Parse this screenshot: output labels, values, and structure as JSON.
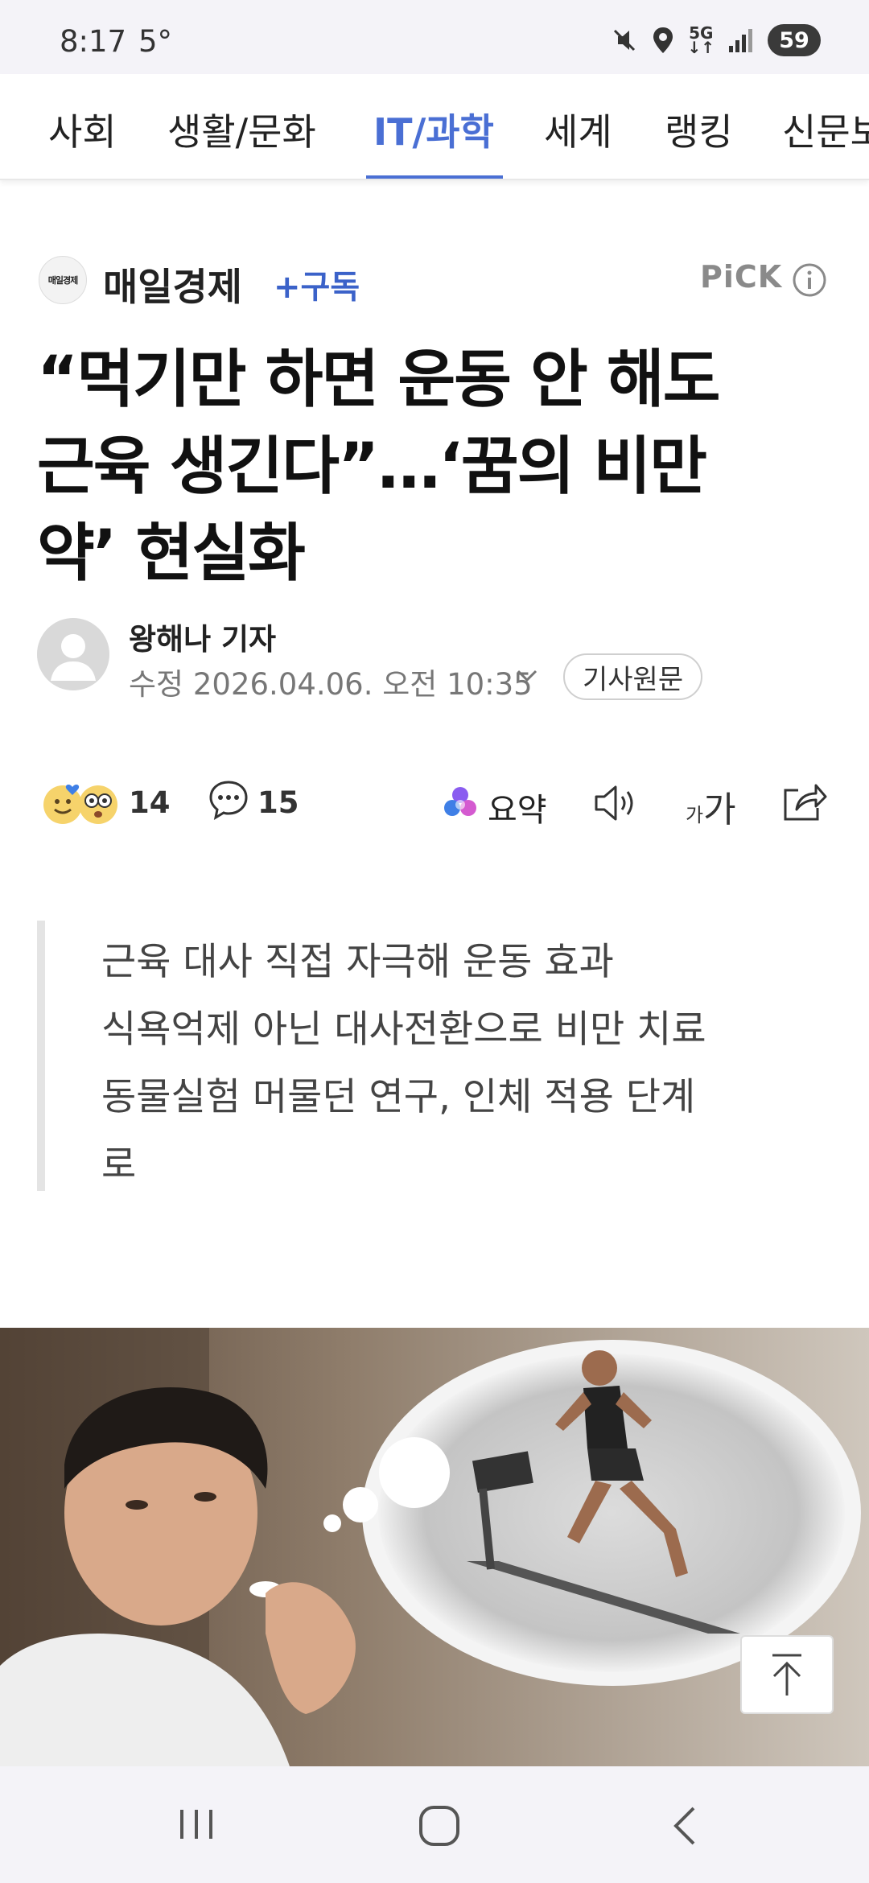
{
  "status_bar": {
    "time": "8:17",
    "temperature": "5°",
    "network": "5G",
    "battery": "59"
  },
  "tabs": [
    {
      "label": "사회",
      "active": false
    },
    {
      "label": "생활/문화",
      "active": false
    },
    {
      "label": "IT/과학",
      "active": true
    },
    {
      "label": "세계",
      "active": false
    },
    {
      "label": "랭킹",
      "active": false
    },
    {
      "label": "신문보",
      "active": false
    }
  ],
  "press": {
    "logo_text": "매일경제",
    "name": "매일경제",
    "subscribe_label": "+구독",
    "pick_label": "PiCK"
  },
  "article": {
    "headline_lines": [
      "“먹기만 하면 운동 안 해도",
      "근육 생긴다”…‘꿈의 비만",
      "약’ 현실화"
    ],
    "reporter": "왕해나 기자",
    "date_label": "수정",
    "date": "2026.04.06. 오전 10:35",
    "original_button": "기사원문",
    "summary_lines": [
      "근육 대사 직접 자극해 운동 효과",
      "식욕억제 아닌 대사전환으로 비만 치료",
      "동물실험 머물던 연구, 인체 적용 단계",
      "로"
    ]
  },
  "actions": {
    "reaction_count": "14",
    "comment_count": "15",
    "summary_label": "요약",
    "font_small": "가",
    "font_large": "가"
  },
  "colors": {
    "accent": "#4a6fd4",
    "subscribe": "#3b62c9",
    "pick_gray": "#8a8a8a"
  },
  "icons": {
    "info": "info-icon",
    "comment": "comment-icon",
    "summary": "sparkle-icon",
    "speaker": "speaker-icon",
    "share": "share-icon",
    "scroll_top": "arrow-up-icon"
  }
}
